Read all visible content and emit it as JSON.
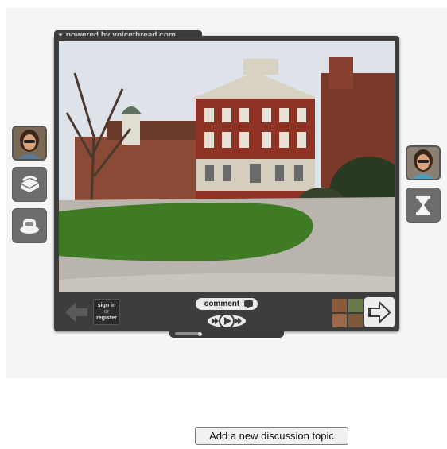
{
  "player": {
    "powered_by": "powered by voicethread.com",
    "sign_in": "sign in",
    "or": "or",
    "register": "register",
    "comment_label": "comment",
    "photo_subject": "campus building",
    "progress_fraction": 0.25
  },
  "left_commenters": [
    {
      "name": "commenter avatar",
      "icon": "avatar"
    },
    {
      "name": "phone comment",
      "icon": "phone-icon"
    },
    {
      "name": "webcam comment",
      "icon": "webcam-icon"
    }
  ],
  "right_commenters": [
    {
      "name": "commenter avatar",
      "icon": "avatar"
    },
    {
      "name": "processing",
      "icon": "hourglass-icon"
    }
  ],
  "discussion": {
    "add_topic_label": "Add a new discussion topic"
  },
  "colors": {
    "player_frame": "#3d3d3d",
    "button_gray": "#6d6d6d",
    "page_bg": "#f5f5f5",
    "lawn": "#3f7a24"
  }
}
